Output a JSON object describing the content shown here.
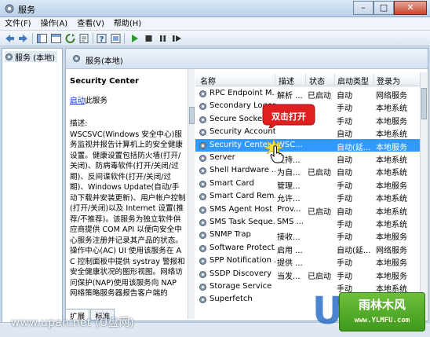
{
  "window": {
    "title": "服务",
    "minimize": "–",
    "maximize": "□",
    "close": "✕"
  },
  "menu": [
    "文件(F)",
    "操作(A)",
    "查看(V)",
    "帮助(H)"
  ],
  "tree": {
    "root_label": "服务 (本地)"
  },
  "pane_header": {
    "title": "服务(本地)"
  },
  "description": {
    "service_name": "Security Center",
    "start_link": "启动",
    "start_suffix": "此服务",
    "desc_label": "描述:",
    "desc_text": "WSCSVC(Windows 安全中心)服务监视并报告计算机上的安全健康设置。健康设置包括防火墙(打开/关闭)、防病毒软件(打开/关闭/过期)、反间谍软件(打开/关闭/过期)、Windows Update(自动/手动下载并安装更新)、用户帐户控制(打开/关闭)以及 Internet 设置(推荐/不推荐)。该服务为独立软件供应商提供 COM API 以便向安全中心服务注册并记录其产品的状态。操作中心(AC) UI 使用该服务在 AC 控制面板中提供 systray 警报和安全健康状况的图形视图。网络访问保护(NAP)使用该服务向 NAP 网络策略服务器报告客户端的"
  },
  "columns": [
    "名称",
    "描述",
    "状态",
    "启动类型",
    "登录为"
  ],
  "services": [
    {
      "name": "RPC Endpoint M...",
      "desc": "解析 ...",
      "status": "已启动",
      "start": "自动",
      "logon": "网络服务"
    },
    {
      "name": "Secondary Logon",
      "desc": "",
      "status": "",
      "start": "手动",
      "logon": "本地系统"
    },
    {
      "name": "Secure Socket",
      "desc": "",
      "status": "",
      "start": "手动",
      "logon": "本地服务"
    },
    {
      "name": "Security Account...",
      "desc": "",
      "status": "",
      "start": "自动",
      "logon": "本地系统"
    },
    {
      "name": "Security Center",
      "desc": "WSC...",
      "status": "",
      "start": "自动(延...",
      "logon": "本地服务"
    },
    {
      "name": "Server",
      "desc": "支持...",
      "status": "",
      "start": "自动",
      "logon": "本地系统"
    },
    {
      "name": "Shell Hardware ...",
      "desc": "为自...",
      "status": "已启动",
      "start": "自动",
      "logon": "本地系统"
    },
    {
      "name": "Smart Card",
      "desc": "管理...",
      "status": "",
      "start": "手动",
      "logon": "本地服务"
    },
    {
      "name": "Smart Card Rem...",
      "desc": "允许...",
      "status": "",
      "start": "手动",
      "logon": "本地系统"
    },
    {
      "name": "SMS Agent Host",
      "desc": "Prov...",
      "status": "已启动",
      "start": "自动",
      "logon": "本地系统"
    },
    {
      "name": "SMS Task Seque...",
      "desc": "SMS ...",
      "status": "",
      "start": "手动",
      "logon": "本地系统"
    },
    {
      "name": "SNMP Trap",
      "desc": "接收...",
      "status": "",
      "start": "手动",
      "logon": "本地服务"
    },
    {
      "name": "Software Protect...",
      "desc": "启用 ...",
      "status": "",
      "start": "自动(延...",
      "logon": "网络服务"
    },
    {
      "name": "SPP Notification ...",
      "desc": "提供 ...",
      "status": "",
      "start": "手动",
      "logon": "本地服务"
    },
    {
      "name": "SSDP Discovery",
      "desc": "当发...",
      "status": "已启动",
      "start": "手动",
      "logon": "本地服务"
    },
    {
      "name": "Storage Service",
      "desc": "",
      "status": "",
      "start": "手动",
      "logon": "本地系统"
    },
    {
      "name": "Superfetch",
      "desc": "",
      "status": "",
      "start": "自动",
      "logon": "本地系统"
    }
  ],
  "selected_index": 4,
  "tabs": [
    "扩展",
    "标准"
  ],
  "annotation": {
    "callout_text": "双击打开"
  },
  "overlay": {
    "watermark_text": "www.upan.net (U盘网)",
    "logo_text": "雨林木风",
    "logo_url": "www.YLMFU.com",
    "big_u": "U"
  },
  "colors": {
    "selection": "#3399ff",
    "link": "#0033cc",
    "callout": "#e02020",
    "logo_green": "#4fa82a"
  }
}
